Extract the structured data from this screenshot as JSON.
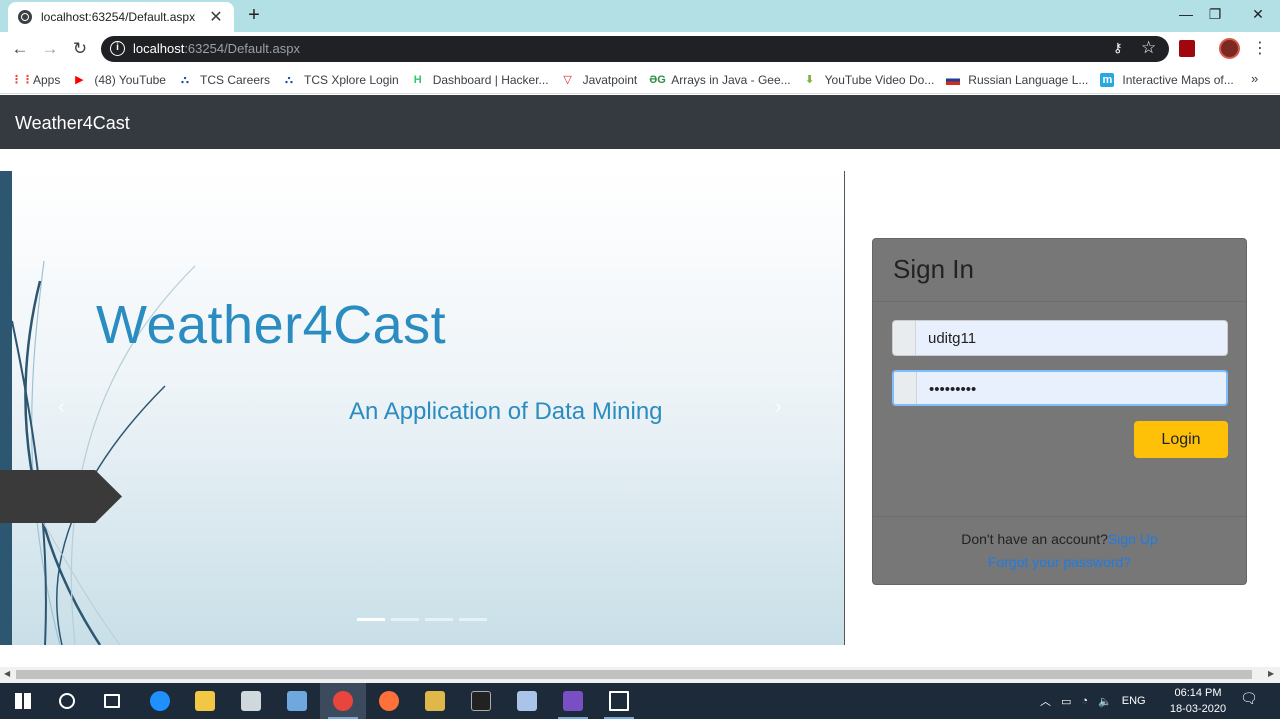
{
  "browser": {
    "tab_title": "localhost:63254/Default.aspx",
    "tab_close": "✕",
    "new_tab": "+",
    "url_host": "localhost",
    "url_path": ":63254/Default.aspx",
    "window_controls": {
      "minimize": "—",
      "maximize": "❐",
      "close": "✕"
    },
    "nav": {
      "back": "←",
      "forward": "→",
      "reload": "↻"
    }
  },
  "bookmarks": [
    {
      "label": "Apps",
      "icon": "apps-grid-icon",
      "color": "#ea4335"
    },
    {
      "label": "(48) YouTube",
      "icon": "youtube-icon",
      "color": "#ff0000"
    },
    {
      "label": "TCS Careers",
      "icon": "tcs-icon",
      "color": "#1f4e9c"
    },
    {
      "label": "TCS Xplore Login",
      "icon": "tcs-icon",
      "color": "#1f4e9c"
    },
    {
      "label": "Dashboard | Hacker...",
      "icon": "hackerrank-icon",
      "color": "#2ec866"
    },
    {
      "label": "Javatpoint",
      "icon": "javatpoint-icon",
      "color": "#d6262c"
    },
    {
      "label": "Arrays in Java - Gee...",
      "icon": "geeksforgeeks-icon",
      "color": "#2f8d46"
    },
    {
      "label": "YouTube Video Do...",
      "icon": "download-arrow-icon",
      "color": "#7cb342"
    },
    {
      "label": "Russian Language L...",
      "icon": "russian-flag-icon",
      "color": "#1c3f94"
    },
    {
      "label": "Interactive Maps of...",
      "icon": "maps-icon",
      "color": "#29a8e0"
    }
  ],
  "bookmarks_more": "»",
  "site": {
    "brand": "Weather4Cast",
    "carousel": {
      "title": "Weather4Cast",
      "subtitle": "An Application of Data Mining",
      "prev": "‹",
      "next": "›",
      "indicator_count": 4,
      "active_indicator": 0
    },
    "signin": {
      "title": "Sign In",
      "username_value": "uditg11",
      "password_value": "•••••••••",
      "login_label": "Login",
      "no_account_text": "Don't have an account?",
      "signup_label": "Sign Up",
      "forgot_label": "Forgot your password?"
    }
  },
  "taskbar": {
    "apps": [
      "windows-start-icon",
      "search-circle-icon",
      "task-view-icon",
      "edge-icon",
      "file-explorer-icon",
      "settings-gear-icon",
      "notepad-icon",
      "chrome-icon",
      "firefox-icon",
      "sql-server-icon",
      "terminal-icon",
      "eclipse-icon",
      "visual-studio-icon",
      "photos-icon"
    ],
    "lang": "ENG",
    "time": "06:14 PM",
    "date": "18-03-2020"
  }
}
